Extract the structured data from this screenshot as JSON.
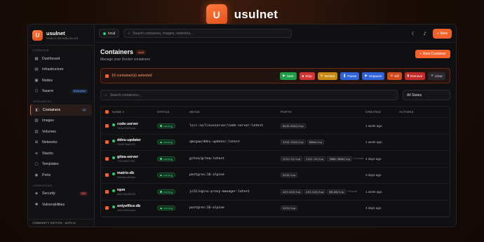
{
  "brand": {
    "logo_letter": "U",
    "name": "usulnet"
  },
  "sidebar": {
    "logo_letter": "U",
    "title": "usulnet",
    "tagline": "FEAR IS THE MIND-KILLER",
    "sections": {
      "overview": "OVERVIEW",
      "resources": "RESOURCES",
      "operations": "OPERATIONS"
    },
    "overview_items": [
      {
        "label": "Dashboard",
        "icon": "grid-icon"
      },
      {
        "label": "Infrastructure",
        "icon": "server-icon"
      },
      {
        "label": "Nodes",
        "icon": "node-icon"
      },
      {
        "label": "Swarm",
        "icon": "swarm-icon",
        "badge": "Enterprise"
      }
    ],
    "resource_items": [
      {
        "label": "Containers",
        "icon": "container-icon",
        "badge": "16",
        "active": true
      },
      {
        "label": "Images",
        "icon": "image-icon"
      },
      {
        "label": "Volumes",
        "icon": "volume-icon"
      },
      {
        "label": "Networks",
        "icon": "network-icon"
      },
      {
        "label": "Stacks",
        "icon": "stack-icon"
      },
      {
        "label": "Templates",
        "icon": "template-icon"
      },
      {
        "label": "Ports",
        "icon": "port-icon"
      }
    ],
    "operation_items": [
      {
        "label": "Security",
        "icon": "shield-icon",
        "badge": "390"
      },
      {
        "label": "Vulnerabilities",
        "icon": "bug-icon"
      }
    ],
    "footer": "COMMUNITY EDITION · AGPLv3"
  },
  "topbar": {
    "host": "local",
    "search_placeholder": "Search containers, images, networks...",
    "new_label": "New"
  },
  "page": {
    "title": "Containers",
    "host_tag": "local",
    "subtitle": "Manage your Docker containers",
    "add_label": "New Container"
  },
  "selection": {
    "text": "16 container(s) selected",
    "actions": {
      "start": "Start",
      "stop": "Stop",
      "restart": "Restart",
      "pause": "Pause",
      "unpause": "Unpause",
      "kill": "Kill",
      "remove": "Remove",
      "clear": "Clear"
    }
  },
  "filters": {
    "search_placeholder": "Search containers...",
    "state_value": "All States"
  },
  "table": {
    "headers": {
      "name": "NAME",
      "status": "STATUS",
      "image": "IMAGE",
      "ports": "PORTS",
      "created": "CREATED",
      "actions": "ACTIONS"
    },
    "rows": [
      {
        "name": "code-server",
        "id": "f02b7e549b4a",
        "status": "running",
        "image": "lscr.io/linuxserver/code-server:latest",
        "ports": [
          "8443:8443/tcp"
        ],
        "more": "",
        "created": "1 week ago"
      },
      {
        "name": "ddns-updater",
        "id": "22d9f3ab5235",
        "status": "running",
        "image": "qmcgaw/ddns-updater:latest",
        "ports": [
          "3333:3333/tcp",
          "8000/tcp"
        ],
        "more": "",
        "created": "1 week ago"
      },
      {
        "name": "gitea-server",
        "id": "7f61d5077951",
        "status": "running",
        "image": "gitea/gitea:latest",
        "ports": [
          "2222:22/tcp",
          "2222:22/tcp",
          "3000:3000/tcp"
        ],
        "more": "+1 more",
        "created": "4 days ago"
      },
      {
        "name": "matrix-db",
        "id": "9d6b6cc09b6e",
        "status": "running",
        "image": "postgres:16-alpine",
        "ports": [
          "5432/tcp"
        ],
        "more": "",
        "created": "3 days ago"
      },
      {
        "name": "npm",
        "id": "0e6f46250339",
        "status": "running",
        "image": "jc21/nginx-proxy-manager:latest",
        "ports": [
          "443:443/tcp",
          "443:443/tcp",
          "80:80/tcp"
        ],
        "more": "+3 more",
        "created": "1 week ago"
      },
      {
        "name": "onlyoffice-db",
        "id": "4e01a9e54ab4",
        "status": "running",
        "image": "postgres:16-alpine",
        "ports": [
          "5432/tcp"
        ],
        "more": "",
        "created": "4 days ago"
      }
    ]
  },
  "colors": {
    "accent": "#f2622a",
    "running": "#3ddc84"
  }
}
